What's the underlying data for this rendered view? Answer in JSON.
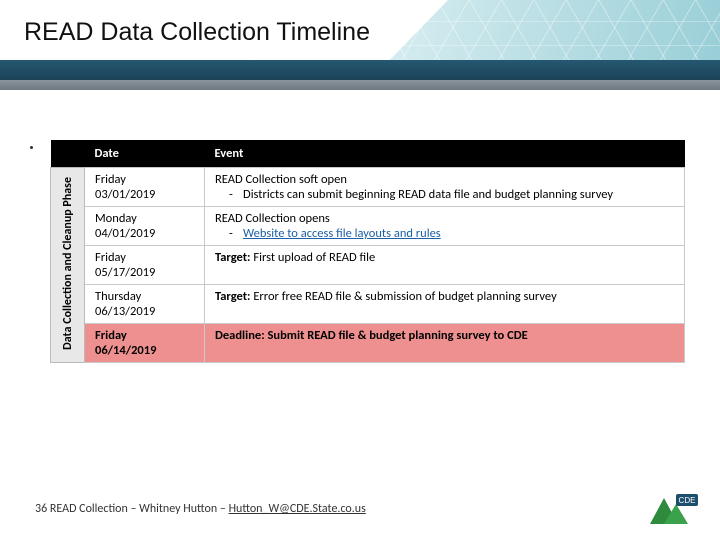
{
  "title": "READ Data Collection Timeline",
  "phase_label": "Data Collection and Cleanup Phase",
  "columns": {
    "date": "Date",
    "event": "Event"
  },
  "rows": [
    {
      "day": "Friday",
      "date": "03/01/2019",
      "headline": "READ Collection soft open",
      "sub1": "Districts can submit beginning READ data file and budget planning survey",
      "link": ""
    },
    {
      "day": "Monday",
      "date": "04/01/2019",
      "headline": "READ Collection opens",
      "sub1": "",
      "link": "Website to access file layouts and rules"
    },
    {
      "day": "Friday",
      "date": "05/17/2019",
      "target_label": "Target:",
      "target_text": " First upload of READ file"
    },
    {
      "day": "Thursday",
      "date": "06/13/2019",
      "target_label": "Target:",
      "target_text": " Error free READ file & submission of budget planning survey"
    },
    {
      "day": "Friday",
      "date": "06/14/2019",
      "deadline_label": "Deadline:",
      "deadline_text": " Submit READ file & budget planning survey to CDE"
    }
  ],
  "footer": {
    "page": "36",
    "text1": " READ Collection – Whitney Hutton – ",
    "email": "Hutton_W@CDE.State.co.us"
  },
  "logo": {
    "cde": "CDE"
  }
}
